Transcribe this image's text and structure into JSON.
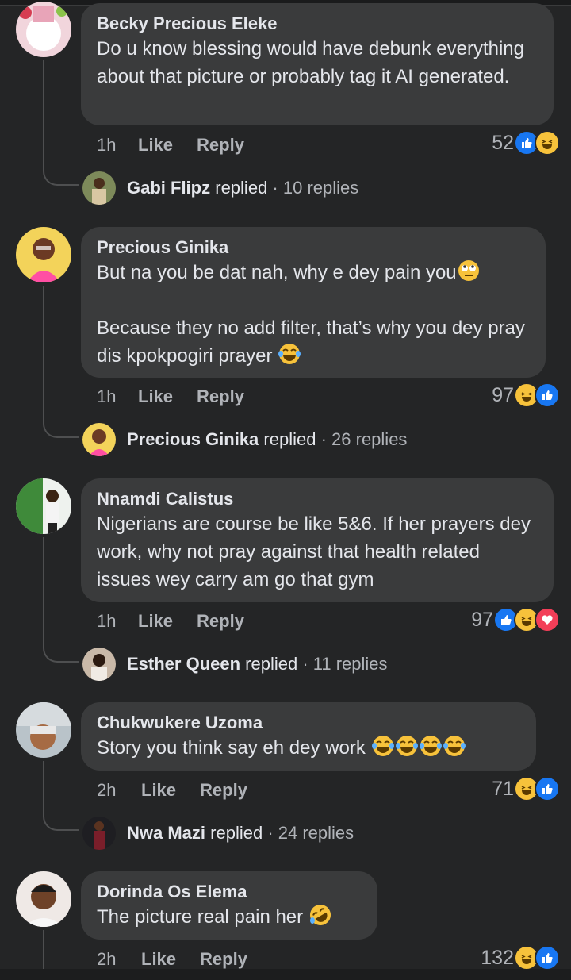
{
  "comments": [
    {
      "name": "Becky Precious Eleke",
      "text": "Do u know blessing would have debunk everything about that picture or probably tag it AI generated.",
      "time": "1h",
      "like": "Like",
      "reply": "Reply",
      "reaction_count": "52",
      "reactions": [
        "like",
        "haha"
      ],
      "reply_preview": {
        "name": "Gabi Flipz",
        "action": "replied",
        "count": "· 10 replies"
      }
    },
    {
      "name": "Precious Ginika",
      "text_line1": "But na you be dat nah, why e dey pain you",
      "text_line2": "Because they no add filter, that’s why you dey pray dis kpokpogiri prayer",
      "time": "1h",
      "like": "Like",
      "reply": "Reply",
      "reaction_count": "97",
      "reactions": [
        "haha",
        "like"
      ],
      "reply_preview": {
        "name": "Precious Ginika",
        "action": "replied",
        "count": "· 26 replies"
      }
    },
    {
      "name": "Nnamdi Calistus",
      "text": "Nigerians are course be like 5&6. If her prayers dey work, why not pray against that health related issues wey carry am go that gym",
      "time": "1h",
      "like": "Like",
      "reply": "Reply",
      "reaction_count": "97",
      "reactions": [
        "like",
        "haha",
        "love"
      ],
      "reply_preview": {
        "name": "Esther Queen",
        "action": "replied",
        "count": "· 11 replies"
      }
    },
    {
      "name": "Chukwukere Uzoma",
      "text": "Story you think say eh dey work",
      "time": "2h",
      "like": "Like",
      "reply": "Reply",
      "reaction_count": "71",
      "reactions": [
        "haha",
        "like"
      ],
      "reply_preview": {
        "name": "Nwa Mazi",
        "action": "replied",
        "count": "· 24 replies"
      }
    },
    {
      "name": "Dorinda Os Elema",
      "text": "The picture real pain her",
      "time": "2h",
      "like": "Like",
      "reply": "Reply",
      "reaction_count": "132",
      "reactions": [
        "haha",
        "like"
      ]
    }
  ],
  "colors": {
    "background": "#242526",
    "bubble": "#3a3b3c",
    "text_primary": "#e4e6eb",
    "text_secondary": "#b0b3b8",
    "like_blue": "#1877f2",
    "haha_yellow": "#f7c23b",
    "love_red": "#f33e58"
  }
}
